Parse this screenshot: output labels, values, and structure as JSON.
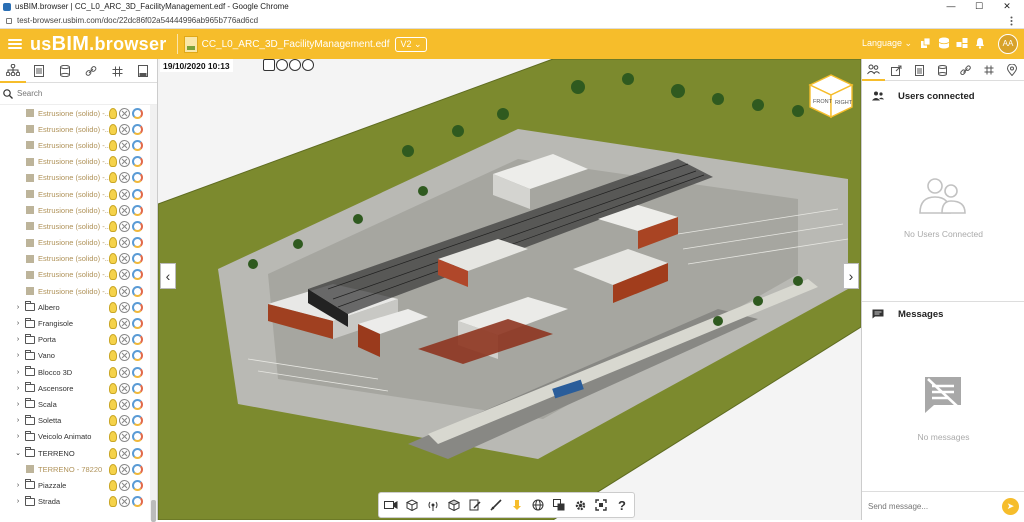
{
  "browser": {
    "tab_title": "usBIM.browser | CC_L0_ARC_3D_FacilityManagement.edf - Google Chrome",
    "url": "test-browser.usbim.com/doc/22dc86f02a54444996ab965b776ad6cd",
    "minimize": "—",
    "maximize": "☐",
    "close": "✕"
  },
  "header": {
    "logo_prefix": "us",
    "logo_bim": "BIM",
    "logo_suffix": ".browser",
    "file_name": "CC_L0_ARC_3D_FacilityManagement.edf",
    "version": "V2 ⌄",
    "language": "Language ⌄",
    "avatar": "AA",
    "accent_color": "#f6bd2b"
  },
  "left_panel": {
    "search_placeholder": "Search",
    "tree": [
      {
        "label": "Estrusione (solido) -...",
        "type": "item"
      },
      {
        "label": "Estrusione (solido) -...",
        "type": "item"
      },
      {
        "label": "Estrusione (solido) -...",
        "type": "item"
      },
      {
        "label": "Estrusione (solido) -...",
        "type": "item"
      },
      {
        "label": "Estrusione (solido) -...",
        "type": "item"
      },
      {
        "label": "Estrusione (solido) -...",
        "type": "item"
      },
      {
        "label": "Estrusione (solido) -...",
        "type": "item"
      },
      {
        "label": "Estrusione (solido) -...",
        "type": "item"
      },
      {
        "label": "Estrusione (solido) -...",
        "type": "item"
      },
      {
        "label": "Estrusione (solido) -...",
        "type": "item"
      },
      {
        "label": "Estrusione (solido) -...",
        "type": "item"
      },
      {
        "label": "Estrusione (solido) -...",
        "type": "item"
      },
      {
        "label": "Albero",
        "type": "folder"
      },
      {
        "label": "Frangisole",
        "type": "folder"
      },
      {
        "label": "Porta",
        "type": "folder"
      },
      {
        "label": "Vano",
        "type": "folder"
      },
      {
        "label": "Blocco 3D",
        "type": "folder"
      },
      {
        "label": "Ascensore",
        "type": "folder"
      },
      {
        "label": "Scala",
        "type": "folder"
      },
      {
        "label": "Soletta",
        "type": "folder"
      },
      {
        "label": "Veicolo Animato",
        "type": "folder"
      },
      {
        "label": "TERRENO",
        "type": "folder-open"
      },
      {
        "label": "TERRENO - 78220",
        "type": "item"
      },
      {
        "label": "Piazzale",
        "type": "folder"
      },
      {
        "label": "Strada",
        "type": "folder"
      }
    ]
  },
  "viewport": {
    "datetime": "19/10/2020 10:13",
    "viewcube_front": "FRONT",
    "viewcube_right": "RIGHT",
    "prev_arrow": "‹",
    "next_arrow": "›",
    "help": "?"
  },
  "right_panel": {
    "users_title": "Users connected",
    "users_empty": "No Users Connected",
    "messages_title": "Messages",
    "messages_empty": "No messages",
    "send_placeholder": "Send message...",
    "send_icon": "➤"
  }
}
